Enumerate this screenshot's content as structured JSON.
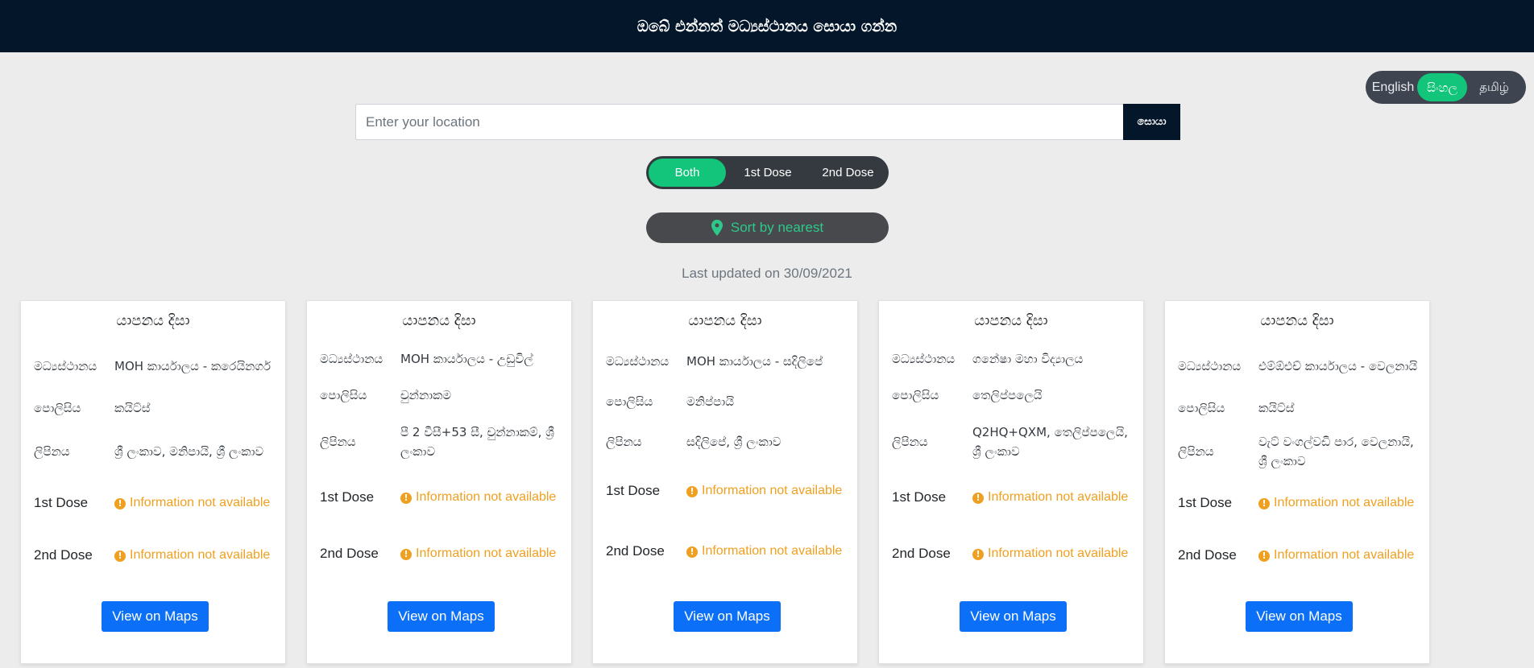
{
  "header": {
    "title": "ඔබේ එන්නත් මධ්‍යස්ථානය සොයා ගන්න"
  },
  "language": {
    "options": [
      "English",
      "සිංහල",
      "தமிழ்"
    ],
    "selected": "සිංහල"
  },
  "search": {
    "placeholder": "Enter your location",
    "value": "",
    "button_label": "සොයා"
  },
  "dose_filter": {
    "options": [
      "Both",
      "1st Dose",
      "2nd Dose"
    ],
    "selected": "Both"
  },
  "sort": {
    "label": "Sort by nearest",
    "icon": "map-pin-icon"
  },
  "last_updated": "Last updated on 30/09/2021",
  "labels": {
    "center": "මධ්‍යස්ථානය",
    "police": "පොලිසිය",
    "address": "ලිපිනය",
    "dose1": "1st Dose",
    "dose2": "2nd Dose",
    "maps_button": "View on Maps"
  },
  "status_colors": {
    "warning": "#f0a020",
    "accent": "#12c57a",
    "primary": "#0b6ff7"
  },
  "cards": [
    {
      "district": "යාපනය දිසා",
      "center": "MOH කාර්යාලය - කරෙයිනගර්",
      "police": "කයිට්ස්",
      "address": "ශ්‍රී ලංකාව, මනිපායි, ශ්‍රී ලංකාව",
      "dose1": "Information not available",
      "dose2": "Information not available"
    },
    {
      "district": "යාපනය දිසා",
      "center": "MOH කාර්යාලය - උඩුවිල්",
      "police": "චුන්නාකම",
      "address": "පී 2 වීසී+53 සී, චුන්නාකම්, ශ්‍රී ලංකාව",
      "dose1": "Information not available",
      "dose2": "Information not available"
    },
    {
      "district": "යාපනය දිසා",
      "center": "MOH කාර්යාලය - සදිලිපේ",
      "police": "මනිප්පායි",
      "address": "සදිලිපේ, ශ්‍රී ලංකාව",
      "dose1": "Information not available",
      "dose2": "Information not available"
    },
    {
      "district": "යාපනය දිසා",
      "center": "ගනේෂා මහා විද්‍යාලය",
      "police": "තෙලිප්පලෙයි",
      "address": "Q2HQ+QXM, තෙලිප්පලෙයි, ශ්‍රී ලංකාව",
      "dose1": "Information not available",
      "dose2": "Information not available"
    },
    {
      "district": "යාපනය දිසා",
      "center": "එම්ඕඑච් කාර්යාලය - වෙලනායි",
      "police": "කයිට්ස්",
      "address": "වැට් වංගල්වඩි පාර, වෙලනායි, ශ්‍රී ලංකාව",
      "dose1": "Information not available",
      "dose2": "Information not available"
    }
  ]
}
